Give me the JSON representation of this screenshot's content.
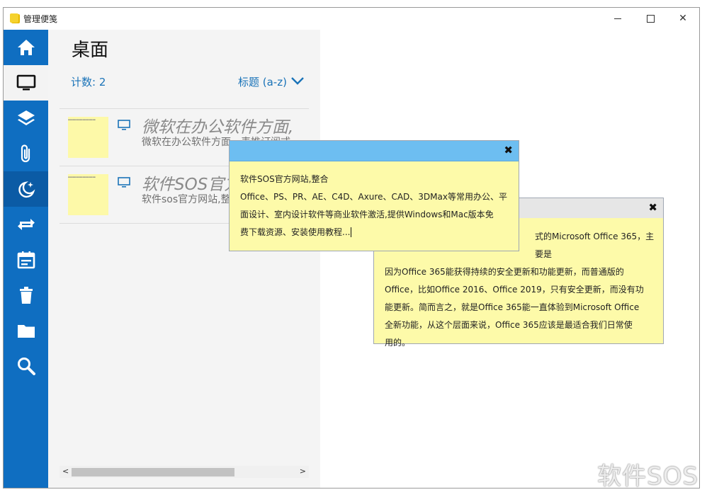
{
  "window": {
    "title": "管理便笺"
  },
  "sidebar": {
    "items": [
      {
        "icon": "home-icon"
      },
      {
        "icon": "desktop-icon"
      },
      {
        "icon": "layers-icon"
      },
      {
        "icon": "paperclip-icon"
      },
      {
        "icon": "moon-stars-icon"
      },
      {
        "icon": "sync-icon"
      },
      {
        "icon": "calendar-icon"
      },
      {
        "icon": "trash-icon"
      },
      {
        "icon": "folder-icon"
      },
      {
        "icon": "search-icon"
      }
    ]
  },
  "list": {
    "title": "桌面",
    "count": "计数: 2",
    "sort": "标题 (a-z)",
    "rows": [
      {
        "title": "微软在办公软件方面,",
        "subtitle": "微软在办公软件方面，表推订阅式"
      },
      {
        "title": "软件SOS官方",
        "subtitle": "软件sos官方网站,整合"
      }
    ]
  },
  "note_front": {
    "line1": "软件SOS官方网站,整合",
    "line2": "Office、PS、PR、AE、C4D、Axure、CAD、3DMax等常用办公、平",
    "line3": "面设计、室内设计软件等商业软件激活,提供Windows和Mac版本免",
    "line4": "费下载资源、安装使用教程..."
  },
  "note_back": {
    "line1": "式的Microsoft Office 365，主要是",
    "line2": "因为Office 365能获得持续的安全更新和功能更新，而普通版的",
    "line3": "Office，比如Office 2016、Office 2019，只有安全更新，而没有功",
    "line4": "能更新。简而言之，就是Office 365能一直体验到Microsoft Office",
    "line5": "全新功能，从这个层面来说，Office 365应该是最适合我们日常使",
    "line6": "用的。"
  },
  "watermark": "软件SOS",
  "colors": {
    "sidebar": "#0f6ec1",
    "accent": "#1a73b8",
    "note": "#fdfaa9",
    "note_header_active": "#6dbef1"
  }
}
